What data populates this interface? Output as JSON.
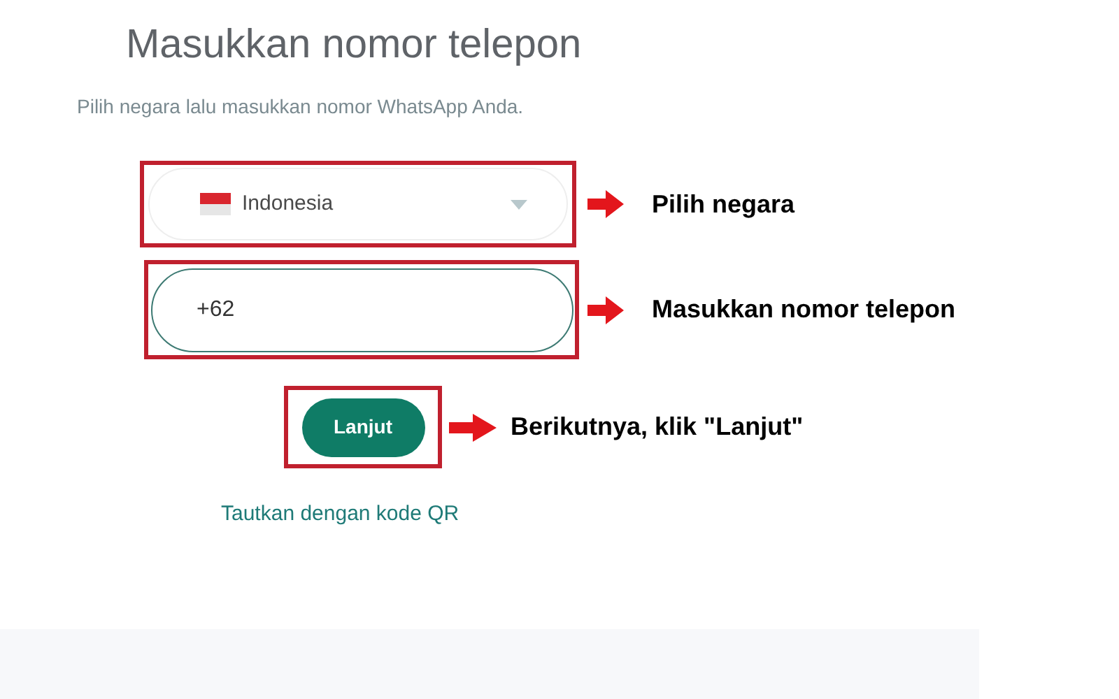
{
  "title": "Masukkan nomor telepon",
  "subtitle": "Pilih negara lalu masukkan nomor WhatsApp Anda.",
  "steps": [
    {
      "kind": "select",
      "value": "Indonesia",
      "annotation": "Pilih negara"
    },
    {
      "kind": "phone",
      "value": "+62",
      "annotation": "Masukkan nomor telepon"
    },
    {
      "kind": "button",
      "value": "Lanjut",
      "annotation": "Berikutnya, klik \"Lanjut\""
    }
  ],
  "link": "Tautkan dengan kode QR"
}
